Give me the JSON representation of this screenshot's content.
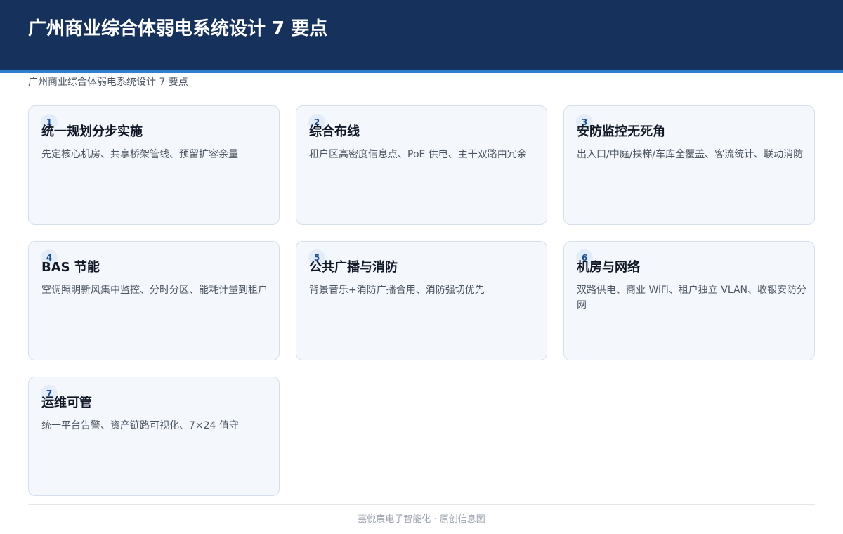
{
  "header": {
    "title": "广州商业综合体弱电系统设计 7 要点"
  },
  "subtitle": "广州商业综合体弱电系统设计 7 要点",
  "cards": [
    {
      "num": "1",
      "title": "统一规划分步实施",
      "desc": "先定核心机房、共享桥架管线、预留扩容余量"
    },
    {
      "num": "2",
      "title": "综合布线",
      "desc": "租户区高密度信息点、PoE 供电、主干双路由冗余"
    },
    {
      "num": "3",
      "title": "安防监控无死角",
      "desc": "出入口/中庭/扶梯/车库全覆盖、客流统计、联动消防"
    },
    {
      "num": "4",
      "title": "BAS 节能",
      "desc": "空调照明新风集中监控、分时分区、能耗计量到租户"
    },
    {
      "num": "5",
      "title": "公共广播与消防",
      "desc": "背景音乐+消防广播合用、消防强切优先"
    },
    {
      "num": "6",
      "title": "机房与网络",
      "desc": "双路供电、商业 WiFi、租户独立 VLAN、收银安防分网"
    },
    {
      "num": "7",
      "title": "运维可管",
      "desc": "统一平台告警、资产链路可视化、7×24 值守"
    }
  ],
  "footer": "嘉悦宸电子智能化 · 原创信息图"
}
